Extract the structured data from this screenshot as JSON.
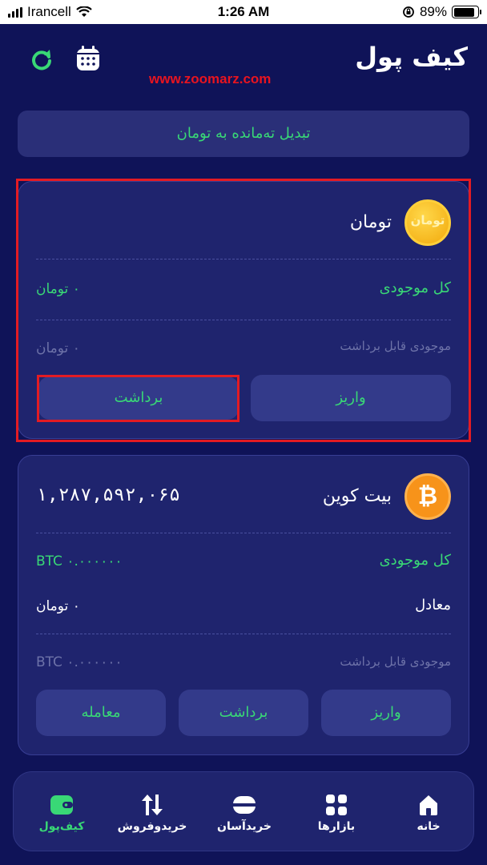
{
  "status_bar": {
    "carrier": "Irancell",
    "time": "1:26 AM",
    "battery": "89%",
    "battery_level": 0.89
  },
  "header": {
    "title": "کیف پول",
    "watermark": "www.zoomarz.com"
  },
  "convert_label": "تبدیل ته‌مانده به تومان",
  "toman_card": {
    "coin_text": "تومان",
    "name": "تومان",
    "total_label": "کل موجودی",
    "total_value": "۰ تومان",
    "available_label": "موجودی قابل برداشت",
    "available_value": "۰ تومان",
    "deposit_label": "واریز",
    "withdraw_label": "برداشت"
  },
  "btc_card": {
    "name": "بیت کوین",
    "coin_symbol": "₿",
    "price": "۱,۲۸۷,۵۹۲,۰۶۵",
    "total_label": "کل موجودی",
    "total_value": "BTC ۰.۰۰۰۰۰۰",
    "equivalent_label": "معادل",
    "equivalent_value": "۰ تومان",
    "available_label": "موجودی قابل برداشت",
    "available_value": "BTC ۰.۰۰۰۰۰۰",
    "deposit_label": "واریز",
    "withdraw_label": "برداشت",
    "trade_label": "معامله"
  },
  "bottom_nav": [
    {
      "label": "خانه",
      "icon": "home-icon"
    },
    {
      "label": "بازارها",
      "icon": "grid-icon"
    },
    {
      "label": "خریدآسان",
      "icon": "card-icon"
    },
    {
      "label": "خریدوفروش",
      "icon": "buy-sell-icon"
    },
    {
      "label": "کیف‌پول",
      "icon": "wallet-icon"
    }
  ],
  "colors": {
    "background": "#0f1358",
    "card": "#1f246e",
    "accent_green": "#39d876",
    "highlight_red": "#e31b23"
  }
}
